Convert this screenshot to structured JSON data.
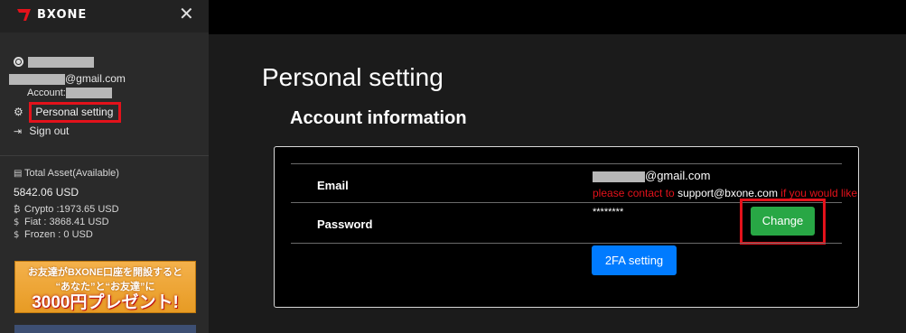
{
  "app": {
    "logo_text": "BXONE",
    "close_icon": "close-icon"
  },
  "sidebar": {
    "email_suffix": "@gmail.com",
    "account_label": "Account:",
    "personal_setting_label": "Personal setting",
    "sign_out_label": "Sign out",
    "assets": {
      "title": "Total Asset(Available)",
      "total": "5842.06 USD",
      "crypto": "Crypto :1973.65 USD",
      "fiat": "Fiat : 3868.41 USD",
      "frozen": "Frozen : 0 USD"
    },
    "banner": {
      "line1": "お友達がBXONE口座を開設すると",
      "line2": "“あなた”と“お友達”に",
      "line3": "3000円プレゼント!"
    }
  },
  "main": {
    "page_title": "Personal setting",
    "section_title": "Account information",
    "email_label": "Email",
    "email_suffix": "@gmail.com",
    "notice_pre": "please contact to ",
    "notice_email": "support@bxone.com",
    "notice_post": " if you would like to change",
    "password_label": "Password",
    "password_value": "********",
    "change_button": "Change",
    "twofa_button": "2FA setting"
  },
  "colors": {
    "highlight": "#e3121b",
    "green_button": "#28a745",
    "blue_button": "#007bff"
  }
}
